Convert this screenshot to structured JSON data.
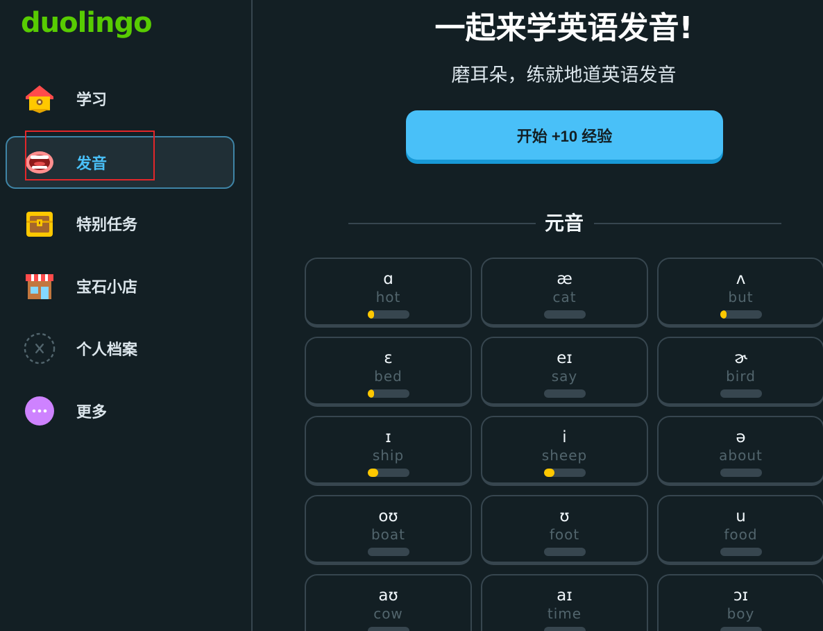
{
  "brand": {
    "logo": "duolingo",
    "accent": "#58cc02"
  },
  "sidebar": {
    "items": [
      {
        "label": "学习",
        "icon": "house-icon"
      },
      {
        "label": "发音",
        "icon": "mouth-icon"
      },
      {
        "label": "特别任务",
        "icon": "treasure-chest-icon"
      },
      {
        "label": "宝石小店",
        "icon": "shop-icon"
      },
      {
        "label": "个人档案",
        "icon": "profile-placeholder-icon"
      },
      {
        "label": "更多",
        "icon": "more-dots-icon"
      }
    ],
    "active_index": 1
  },
  "main": {
    "title": "一起来学英语发音!",
    "subtitle": "磨耳朵，练就地道英语发音",
    "start_button": "开始 +10 经验",
    "section_title": "元音",
    "cards": [
      {
        "symbol": "ɑ",
        "word": "hot",
        "progress": 0.15
      },
      {
        "symbol": "æ",
        "word": "cat",
        "progress": 0
      },
      {
        "symbol": "ʌ",
        "word": "but",
        "progress": 0.15
      },
      {
        "symbol": "ɛ",
        "word": "bed",
        "progress": 0.15
      },
      {
        "symbol": "eɪ",
        "word": "say",
        "progress": 0
      },
      {
        "symbol": "ɚ",
        "word": "bird",
        "progress": 0
      },
      {
        "symbol": "ɪ",
        "word": "ship",
        "progress": 0.25
      },
      {
        "symbol": "i",
        "word": "sheep",
        "progress": 0.25
      },
      {
        "symbol": "ə",
        "word": "about",
        "progress": 0
      },
      {
        "symbol": "oʊ",
        "word": "boat",
        "progress": 0
      },
      {
        "symbol": "ʊ",
        "word": "foot",
        "progress": 0
      },
      {
        "symbol": "u",
        "word": "food",
        "progress": 0
      },
      {
        "symbol": "aʊ",
        "word": "cow",
        "progress": 0
      },
      {
        "symbol": "aɪ",
        "word": "time",
        "progress": 0
      },
      {
        "symbol": "ɔɪ",
        "word": "boy",
        "progress": 0
      }
    ]
  }
}
